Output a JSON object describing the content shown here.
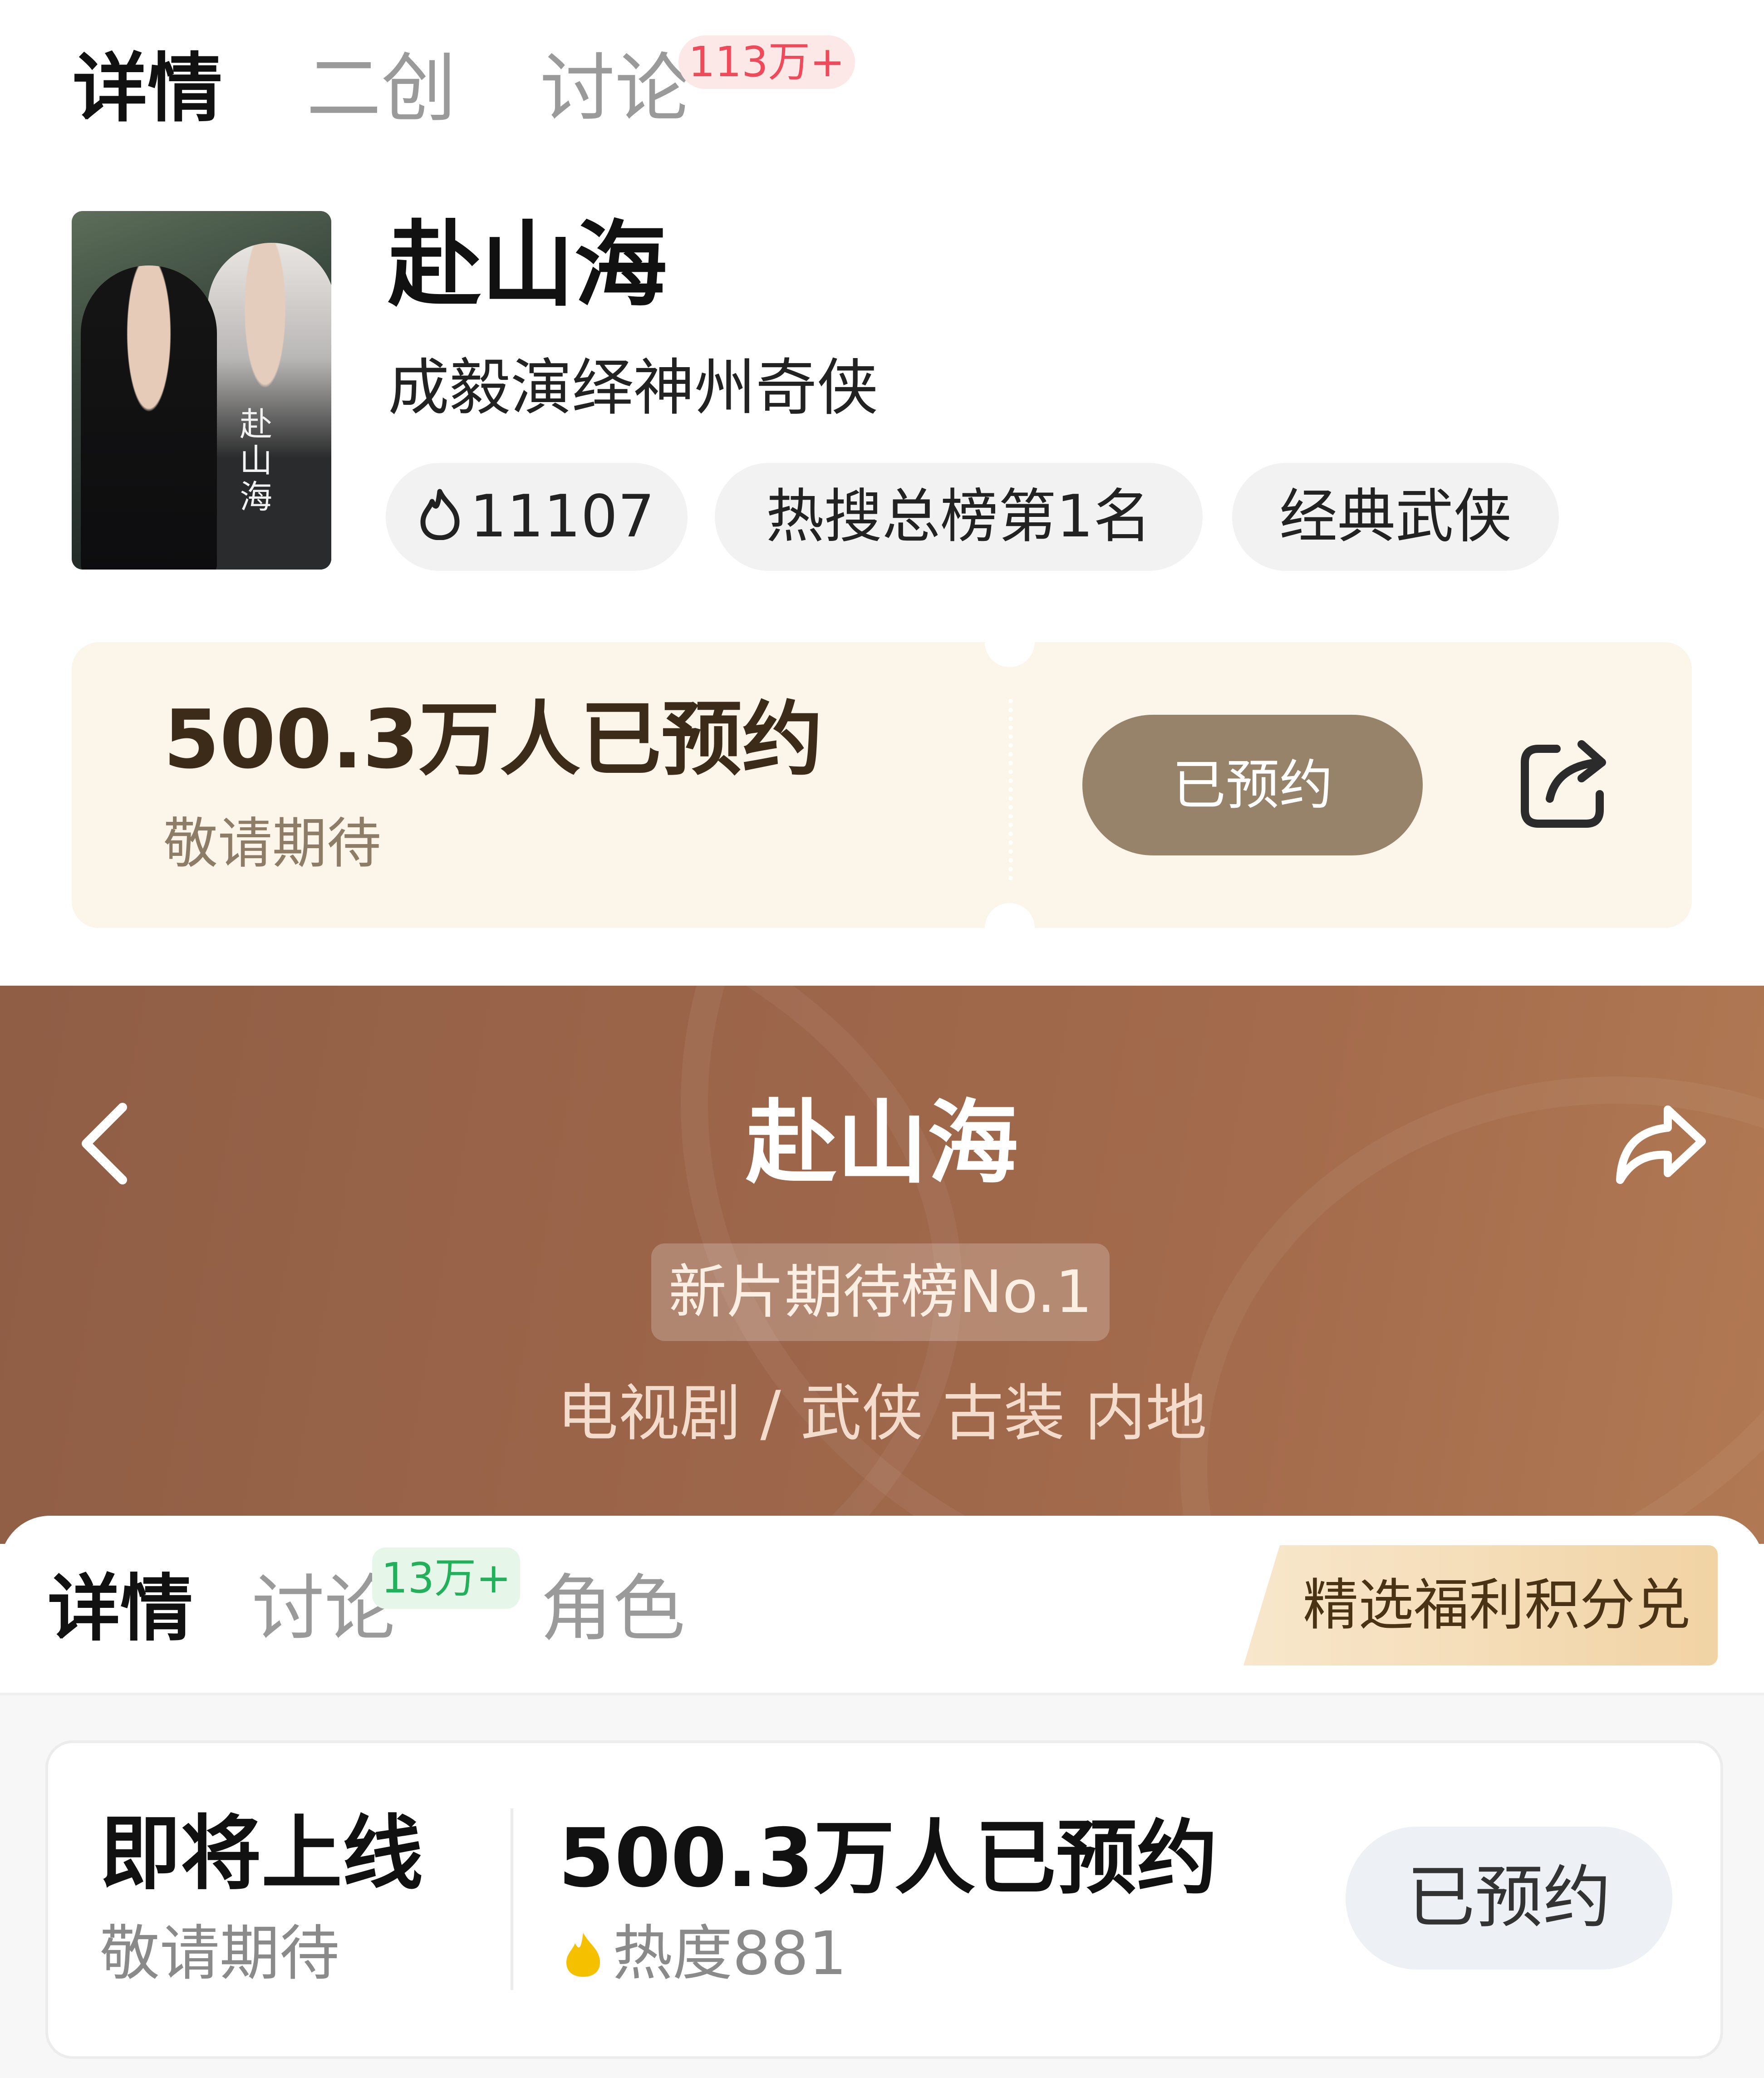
{
  "top": {
    "tabs": [
      {
        "label": "详情"
      },
      {
        "label": "二创"
      },
      {
        "label": "讨论",
        "badge": "113万+"
      }
    ],
    "show": {
      "title": "赴山海",
      "subtitle": "成毅演绎神州奇侠",
      "poster_text": "赴山海",
      "chips": [
        {
          "icon": "flame-icon",
          "label": "11107"
        },
        {
          "label": "热搜总榜第1名"
        },
        {
          "label": "经典武侠"
        }
      ]
    },
    "reserve": {
      "count": "500.3万人已预约",
      "hint": "敬请期待",
      "button": "已预约",
      "share_icon": "share-out-icon"
    }
  },
  "bottom": {
    "banner": {
      "title": "赴山海",
      "rank_badge": "新片期待榜No.1",
      "genre": "电视剧 / 武侠 古装 内地",
      "back_icon": "chevron-left-icon",
      "share_icon": "share-arrow-icon"
    },
    "tabs": [
      {
        "label": "详情"
      },
      {
        "label": "讨论",
        "badge": "13万+"
      },
      {
        "label": "角色"
      }
    ],
    "welfare_button": "精选福利积分兑",
    "status": {
      "title": "即将上线",
      "hint": "敬请期待",
      "count": "500.3万人已预约",
      "heat": "热度881",
      "button": "已预约"
    }
  },
  "colors": {
    "accent_gold": "#97836a",
    "banner_brown": "#9a6449",
    "badge_red": "#f04a5a",
    "badge_green": "#23b05a",
    "heat_flame": "#f5c000"
  }
}
